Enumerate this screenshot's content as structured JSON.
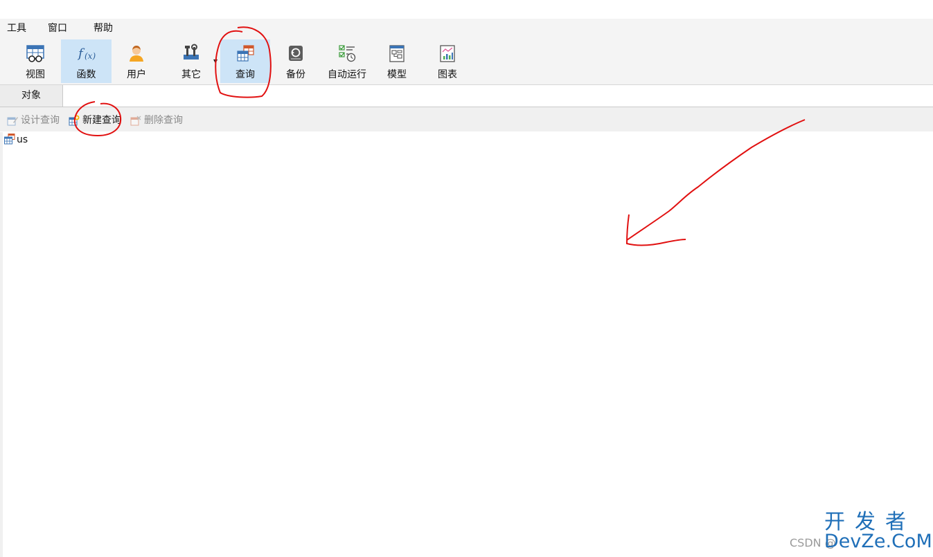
{
  "menu": {
    "items": [
      {
        "label": "工具"
      },
      {
        "label": "窗口"
      },
      {
        "label": "帮助"
      }
    ]
  },
  "ribbon": {
    "buttons": [
      {
        "label": "视图",
        "icon": "view-icon"
      },
      {
        "label": "函数",
        "icon": "function-icon"
      },
      {
        "label": "用户",
        "icon": "user-icon"
      },
      {
        "label": "其它",
        "icon": "tools-icon"
      },
      {
        "label": "查询",
        "icon": "query-icon"
      },
      {
        "label": "备份",
        "icon": "backup-icon"
      },
      {
        "label": "自动运行",
        "icon": "schedule-icon"
      },
      {
        "label": "模型",
        "icon": "model-icon"
      },
      {
        "label": "图表",
        "icon": "chart-icon"
      }
    ],
    "active_buttons": [
      "函数",
      "查询"
    ]
  },
  "tabs": {
    "object_label": "对象"
  },
  "object_toolbar": {
    "design": "设计查询",
    "new": "新建查询",
    "delete": "删除查询"
  },
  "list": {
    "items": [
      {
        "label": "us"
      }
    ]
  },
  "watermark": {
    "csdn": "CSDN @",
    "brand_cn": "开发者",
    "brand_en": "DevZe.CoM"
  },
  "colors": {
    "accent": "#cde4f7",
    "annotation": "#e11010",
    "watermark": "#1f6fb8"
  }
}
